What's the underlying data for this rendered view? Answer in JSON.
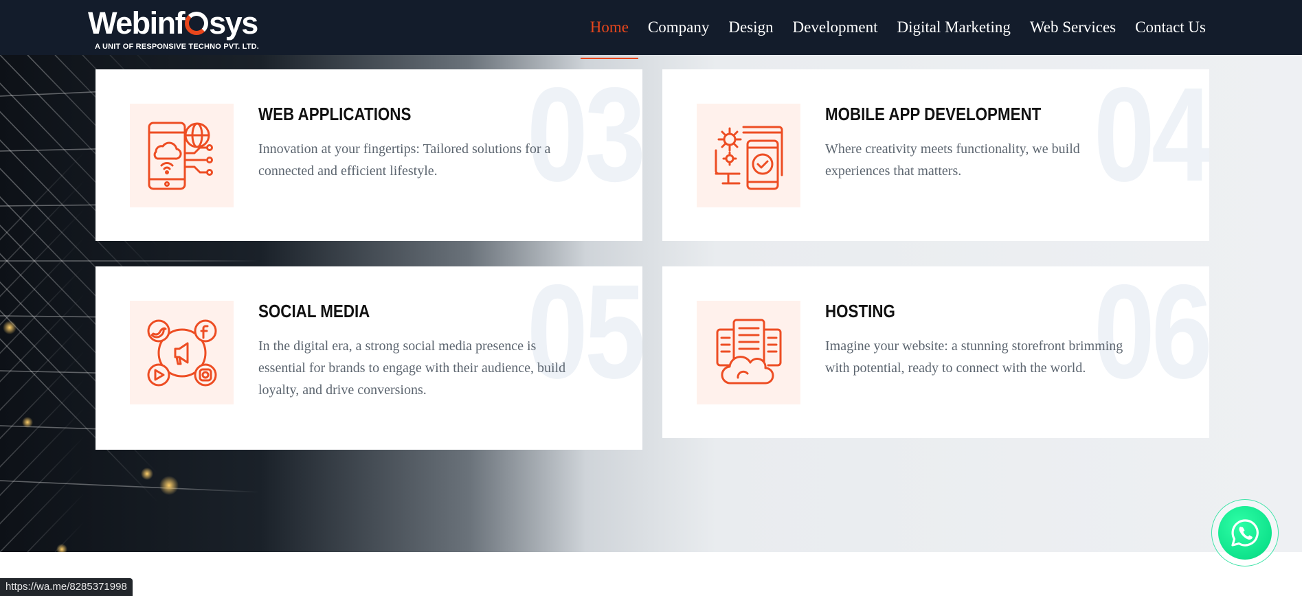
{
  "brand": {
    "name_prefix": "Webinf",
    "name_suffix": "sys",
    "tagline": "A UNIT OF RESPONSIVE TECHNO PVT. LTD.",
    "accent_color": "#e8461c"
  },
  "nav": {
    "items": [
      {
        "label": "Home",
        "active": true
      },
      {
        "label": "Company",
        "active": false
      },
      {
        "label": "Design",
        "active": false
      },
      {
        "label": "Development",
        "active": false
      },
      {
        "label": "Digital Marketing",
        "active": false
      },
      {
        "label": "Web Services",
        "active": false
      },
      {
        "label": "Contact Us",
        "active": false
      }
    ]
  },
  "services": [
    {
      "number": "03",
      "title": "WEB APPLICATIONS",
      "description": "Innovation at your fingertips: Tailored solutions for a connected and efficient lifestyle.",
      "icon": "web-app-icon"
    },
    {
      "number": "04",
      "title": "MOBILE APP DEVELOPMENT",
      "description": "Where creativity meets functionality, we build experiences that matters.",
      "icon": "mobile-app-icon"
    },
    {
      "number": "05",
      "title": "SOCIAL MEDIA",
      "description": "In the digital era, a strong social media presence is essential for brands to engage with their audience, build loyalty, and drive conversions.",
      "icon": "social-media-icon"
    },
    {
      "number": "06",
      "title": "HOSTING",
      "description": "Imagine your website: a stunning storefront brimming with potential, ready to connect with the world.",
      "icon": "hosting-icon"
    }
  ],
  "whatsapp": {
    "icon": "whatsapp-icon",
    "color": "#12e58f"
  },
  "status_bar": {
    "url": "https://wa.me/8285371998"
  }
}
